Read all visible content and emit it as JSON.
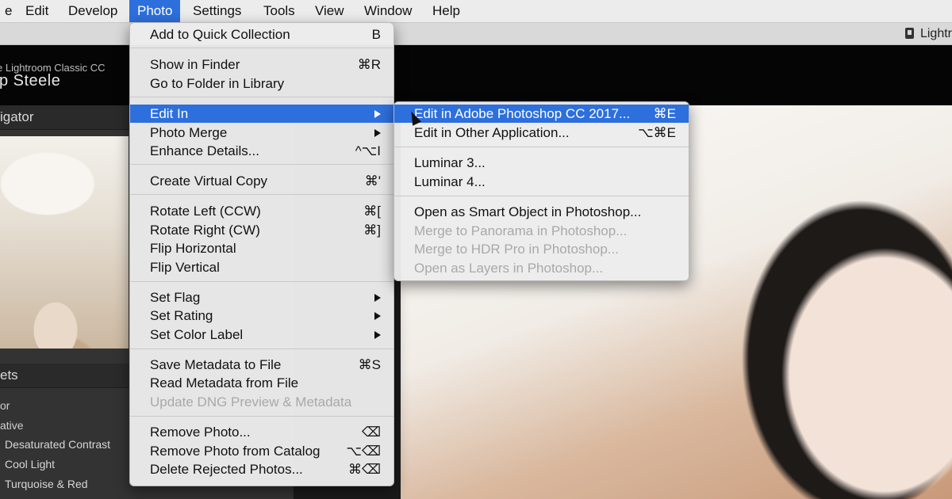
{
  "menubar": {
    "items": [
      {
        "label": "e"
      },
      {
        "label": "Edit"
      },
      {
        "label": "Develop"
      },
      {
        "label": "Photo"
      },
      {
        "label": "Settings"
      },
      {
        "label": "Tools"
      },
      {
        "label": "View"
      },
      {
        "label": "Window"
      },
      {
        "label": "Help"
      }
    ]
  },
  "window": {
    "title": "Lightr"
  },
  "identity_plate": {
    "line1": "e Lightroom Classic CC",
    "line2": "ip Steele"
  },
  "left_panel": {
    "navigator_label": "igator",
    "presets_label": "ets",
    "preset_groups": [
      {
        "label": "or"
      },
      {
        "label": "ative"
      }
    ],
    "preset_items": [
      {
        "label": "Desaturated Contrast"
      },
      {
        "label": "Cool Light"
      },
      {
        "label": "Turquoise & Red"
      }
    ]
  },
  "photo_menu": {
    "items": [
      {
        "label": "Add to Quick Collection",
        "shortcut": "B"
      },
      {
        "label": "Show in Finder",
        "shortcut": "⌘R"
      },
      {
        "label": "Go to Folder in Library",
        "shortcut": ""
      },
      {
        "label": "Edit In",
        "shortcut": ""
      },
      {
        "label": "Photo Merge",
        "shortcut": ""
      },
      {
        "label": "Enhance Details...",
        "shortcut": "^⌥I"
      },
      {
        "label": "Create Virtual Copy",
        "shortcut": "⌘'"
      },
      {
        "label": "Rotate Left (CCW)",
        "shortcut": "⌘["
      },
      {
        "label": "Rotate Right (CW)",
        "shortcut": "⌘]"
      },
      {
        "label": "Flip Horizontal",
        "shortcut": ""
      },
      {
        "label": "Flip Vertical",
        "shortcut": ""
      },
      {
        "label": "Set Flag",
        "shortcut": ""
      },
      {
        "label": "Set Rating",
        "shortcut": ""
      },
      {
        "label": "Set Color Label",
        "shortcut": ""
      },
      {
        "label": "Save Metadata to File",
        "shortcut": "⌘S"
      },
      {
        "label": "Read Metadata from File",
        "shortcut": ""
      },
      {
        "label": "Update DNG Preview & Metadata",
        "shortcut": ""
      },
      {
        "label": "Remove Photo...",
        "shortcut": "⌫"
      },
      {
        "label": "Remove Photo from Catalog",
        "shortcut": "⌥⌫"
      },
      {
        "label": "Delete Rejected Photos...",
        "shortcut": "⌘⌫"
      }
    ]
  },
  "edit_in_submenu": {
    "items": [
      {
        "label": "Edit in Adobe Photoshop CC 2017...",
        "shortcut": "⌘E"
      },
      {
        "label": "Edit in Other Application...",
        "shortcut": "⌥⌘E"
      },
      {
        "label": "Luminar 3...",
        "shortcut": ""
      },
      {
        "label": "Luminar 4...",
        "shortcut": ""
      },
      {
        "label": "Open as Smart Object in Photoshop...",
        "shortcut": ""
      },
      {
        "label": "Merge to Panorama in Photoshop...",
        "shortcut": ""
      },
      {
        "label": "Merge to HDR Pro in Photoshop...",
        "shortcut": ""
      },
      {
        "label": "Open as Layers in Photoshop...",
        "shortcut": ""
      }
    ]
  },
  "colors": {
    "highlight": "#2d6fdc",
    "menu_bg": "#ececec",
    "disabled_text": "#a9a9a9"
  }
}
